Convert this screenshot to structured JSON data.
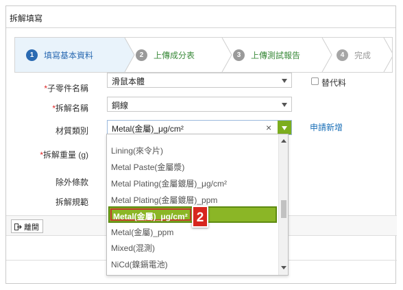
{
  "window": {
    "title": "拆解填寫"
  },
  "wizard": {
    "steps": [
      {
        "num": "1",
        "label": "填寫基本資料"
      },
      {
        "num": "2",
        "label": "上傳成分表"
      },
      {
        "num": "3",
        "label": "上傳測試報告"
      },
      {
        "num": "4",
        "label": "完成"
      }
    ]
  },
  "form": {
    "part_name": {
      "label": "子零件名稱",
      "required": "*",
      "value": "滑鼠本體"
    },
    "substitute": {
      "label": "替代料"
    },
    "disassembly_name": {
      "label": "拆解名稱",
      "required": "*",
      "value": "銅線"
    },
    "material_type": {
      "label": "材質類別",
      "value": "Metal(金屬)_μg/cm²",
      "apply_link": "申請新增"
    },
    "disassembly_weight": {
      "label": "拆解重量 (g)",
      "required": "*"
    },
    "exclusion": {
      "label": "除外條款"
    },
    "disassembly_spec": {
      "label": "拆解規範"
    }
  },
  "toolbar": {
    "leave_label": "離開"
  },
  "dropdown": {
    "options": [
      "Lining(來令片)",
      "Metal Paste(金屬漿)",
      "Metal Plating(金屬鍍層)_μg/cm²",
      "Metal Plating(金屬鍍層)_ppm",
      "Metal(金屬)_μg/cm²",
      "Metal(金屬)_ppm",
      "Mixed(混測)",
      "NiCd(鎳鎘電池)"
    ],
    "selected": "Metal(金屬)_μg/cm²"
  },
  "annotation": {
    "badge": "2"
  },
  "colors": {
    "accent_blue": "#2a6ab2",
    "step_green": "#3a8a3a",
    "highlight_green": "#8bb626",
    "badge_red": "#d7261e"
  }
}
